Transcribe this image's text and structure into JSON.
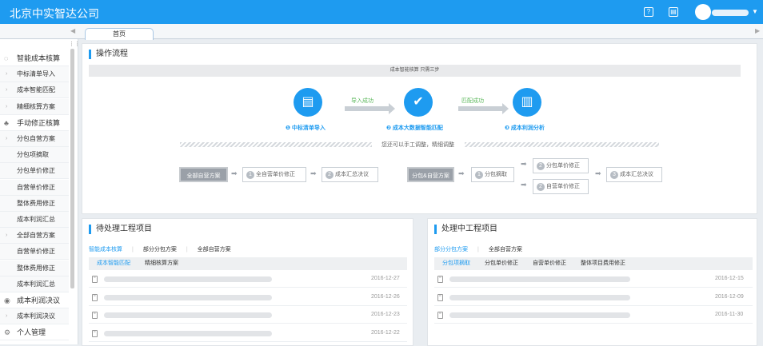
{
  "app": {
    "title": "北京中实智达公司"
  },
  "header_icons": [
    "help-icon",
    "store-icon"
  ],
  "tabs": {
    "home": "首页"
  },
  "sidebar": {
    "items": [
      {
        "type": "group",
        "icon": "cost-calc-icon",
        "label": "智能成本核算"
      },
      {
        "type": "sub",
        "label": "中标清单导入"
      },
      {
        "type": "sub",
        "label": "成本智能匹配"
      },
      {
        "type": "sub",
        "label": "精细核算方案"
      },
      {
        "type": "group",
        "icon": "users-icon",
        "label": "手动修正核算"
      },
      {
        "type": "sub",
        "label": "分包自营方案"
      },
      {
        "type": "leaf",
        "label": "分包项摘取"
      },
      {
        "type": "leaf",
        "label": "分包单价修正"
      },
      {
        "type": "leaf",
        "label": "自营单价修正"
      },
      {
        "type": "leaf",
        "label": "整体费用修正"
      },
      {
        "type": "leaf",
        "label": "成本利润汇总"
      },
      {
        "type": "sub",
        "label": "全部自营方案"
      },
      {
        "type": "leaf",
        "label": "自营单价修正"
      },
      {
        "type": "leaf",
        "label": "整体费用修正"
      },
      {
        "type": "leaf",
        "label": "成本利润汇总"
      },
      {
        "type": "group",
        "icon": "decision-icon",
        "label": "成本利润决议"
      },
      {
        "type": "sub",
        "label": "成本利润决议"
      },
      {
        "type": "group",
        "icon": "gear-icon",
        "label": "个人管理"
      }
    ]
  },
  "flow": {
    "title": "操作流程",
    "header": "成本智能核算 只需三步",
    "steps": [
      {
        "num": "1",
        "label": "中标清单导入"
      },
      {
        "num": "2",
        "label": "成本大数据智能匹配"
      },
      {
        "num": "3",
        "label": "成本利润分析"
      }
    ],
    "arrows": [
      "导入成功",
      "匹配成功"
    ],
    "manual_note": "您还可以手工调整，精细调整",
    "left_path": {
      "start": "全部自营方案",
      "steps": [
        {
          "num": "1",
          "label": "全自营单价修正"
        },
        {
          "num": "2",
          "label": "成本汇总决议"
        }
      ]
    },
    "right_path": {
      "start": "分包&自营方案",
      "s1": {
        "num": "1",
        "label": "分包摘取"
      },
      "s2a": {
        "num": "2",
        "label": "分包单价修正"
      },
      "s2b": {
        "num": "2",
        "label": "自营单价修正"
      },
      "s3": {
        "num": "3",
        "label": "成本汇总决议"
      }
    }
  },
  "pending": {
    "title": "待处理工程项目",
    "tabs": [
      "智能成本核算",
      "部分分包方案",
      "全部自营方案"
    ],
    "subtabs": [
      "成本智能匹配",
      "精细核算方案"
    ],
    "rows": [
      {
        "date": "2016-12-27"
      },
      {
        "date": "2016-12-26"
      },
      {
        "date": "2016-12-23"
      },
      {
        "date": "2016-12-22"
      }
    ]
  },
  "processing": {
    "title": "处理中工程项目",
    "tabs": [
      "部分分包方案",
      "全部自营方案"
    ],
    "subtabs": [
      "分包项摘取",
      "分包单价修正",
      "自营单价修正",
      "整体项目费用修正"
    ],
    "rows": [
      {
        "date": "2016-12-15"
      },
      {
        "date": "2016-12-09"
      },
      {
        "date": "2016-11-30"
      }
    ]
  }
}
